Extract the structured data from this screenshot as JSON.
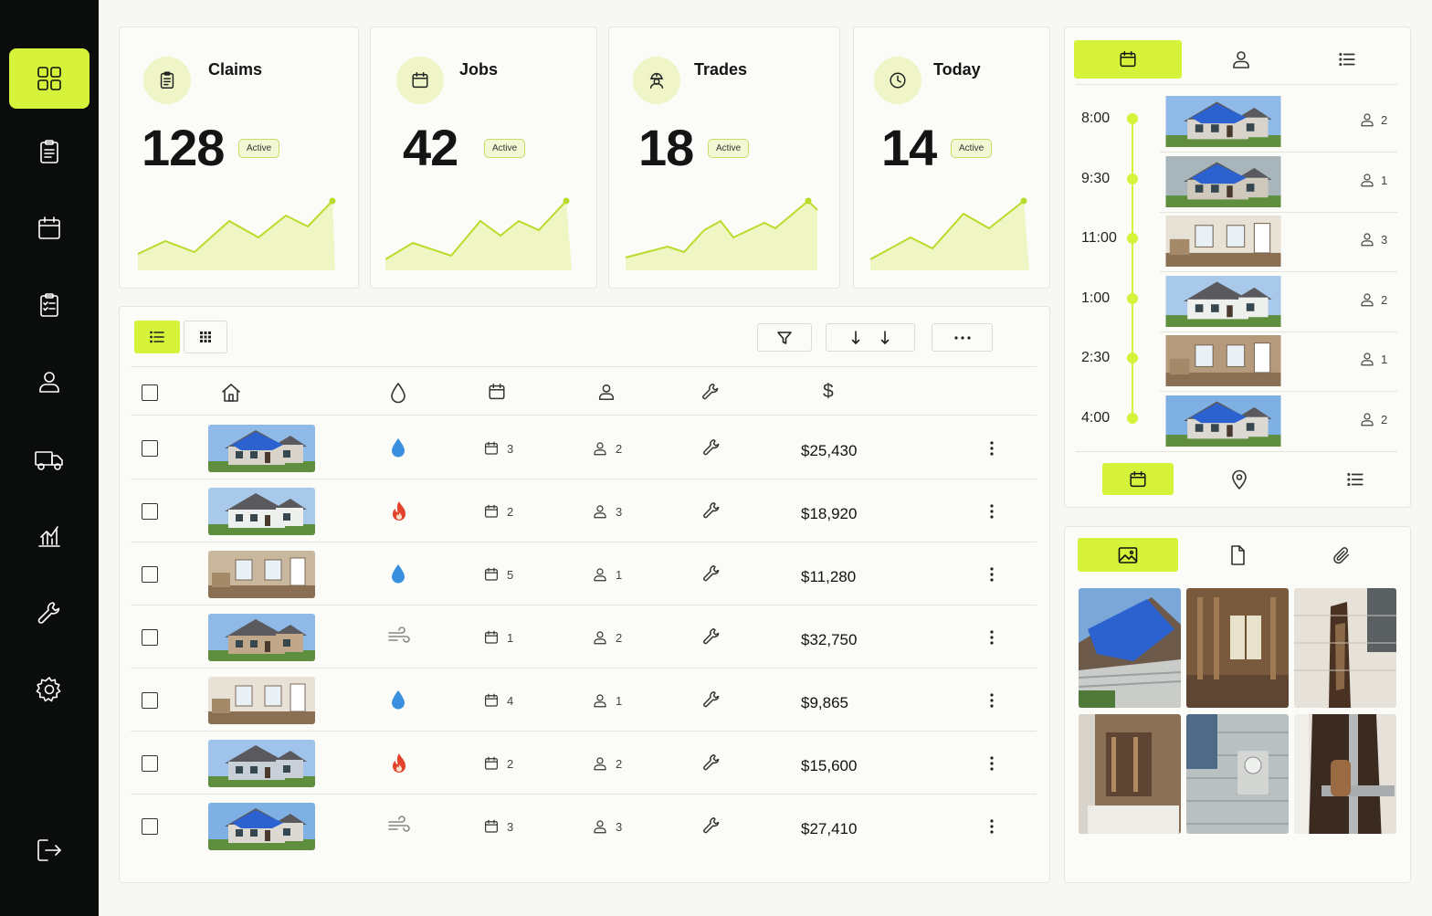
{
  "colors": {
    "accent": "#d6f23a",
    "sidebar_bg": "#0b0c0c",
    "water": "#3a8fde",
    "fire": "#e3432d"
  },
  "sidebar": {
    "items": [
      {
        "icon": "dashboard-grid-icon",
        "active": true
      },
      {
        "icon": "clipboard-icon"
      },
      {
        "icon": "calendar-icon"
      },
      {
        "icon": "checklist-icon"
      },
      {
        "icon": "user-icon"
      },
      {
        "icon": "truck-icon"
      },
      {
        "icon": "bar-chart-icon"
      },
      {
        "icon": "wrench-icon"
      },
      {
        "icon": "gear-icon"
      }
    ],
    "logout_icon": "logout-icon"
  },
  "stats": [
    {
      "title": "Claims",
      "value": "128",
      "badge": "Active",
      "icon": "clipboard-icon"
    },
    {
      "title": "Jobs",
      "value": "42",
      "badge": "Active",
      "icon": "calendar-icon"
    },
    {
      "title": "Trades",
      "value": "18",
      "badge": "Active",
      "icon": "worker-icon"
    },
    {
      "title": "Today",
      "value": "14",
      "badge": "Active",
      "icon": "clock-icon"
    }
  ],
  "table": {
    "toolbar": {
      "view_list": "list-view-icon",
      "view_grid": "grid-view-icon",
      "filter": "filter-icon",
      "sort": "sort-icon",
      "more": "more-icon"
    },
    "header_icons": [
      "home-icon",
      "drop-icon",
      "calendar-icon",
      "user-icon",
      "wrench-icon",
      "dollar-icon"
    ],
    "header_dollar": "$",
    "rows": [
      {
        "damage": "water",
        "days": "3",
        "people": "2",
        "amount": "$25,430"
      },
      {
        "damage": "fire",
        "days": "2",
        "people": "3",
        "amount": "$18,920"
      },
      {
        "damage": "water",
        "days": "5",
        "people": "1",
        "amount": "$11,280"
      },
      {
        "damage": "wind",
        "days": "1",
        "people": "2",
        "amount": "$32,750"
      },
      {
        "damage": "water",
        "days": "4",
        "people": "1",
        "amount": "$9,865"
      },
      {
        "damage": "fire",
        "days": "2",
        "people": "2",
        "amount": "$15,600"
      },
      {
        "damage": "wind",
        "days": "3",
        "people": "3",
        "amount": "$27,410"
      }
    ]
  },
  "schedule": {
    "tabs": [
      "calendar-icon",
      "user-icon",
      "list-icon"
    ],
    "items": [
      {
        "time": "8:00",
        "count": "2"
      },
      {
        "time": "9:30",
        "count": "1"
      },
      {
        "time": "11:00",
        "count": "3"
      },
      {
        "time": "1:00",
        "count": "2"
      },
      {
        "time": "2:30",
        "count": "1"
      },
      {
        "time": "4:00",
        "count": "2"
      }
    ],
    "bottom_tabs": [
      "calendar-icon",
      "location-pin-icon",
      "list-icon"
    ]
  },
  "gallery": {
    "tabs": [
      "image-icon",
      "document-icon",
      "paperclip-icon"
    ],
    "tiles": 6
  }
}
